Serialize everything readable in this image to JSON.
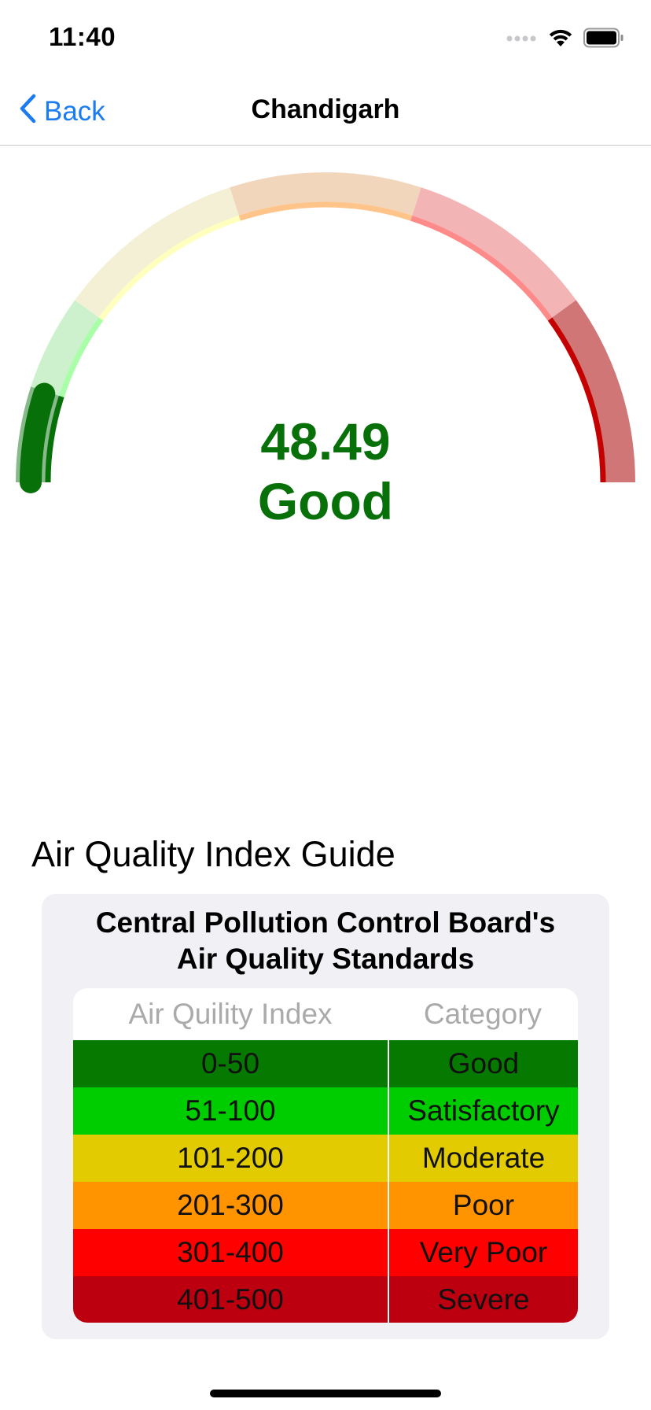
{
  "status_bar": {
    "time": "11:40",
    "icons": [
      "signal-dots-icon",
      "wifi-icon",
      "battery-icon"
    ]
  },
  "nav": {
    "back_label": "Back",
    "title": "Chandigarh",
    "accent_color": "#1a7cf0"
  },
  "gauge": {
    "value": "48.49",
    "category": "Good",
    "value_number": 48.49,
    "max": 500,
    "value_color": "#087008",
    "segments": [
      {
        "from": 0,
        "to": 50,
        "track_color": "#87b98a",
        "fill_color": "#087008"
      },
      {
        "from": 50,
        "to": 100,
        "track_color": "#cdf1cd",
        "fill_color": "#a8ffa8"
      },
      {
        "from": 100,
        "to": 200,
        "track_color": "#f4f0d6",
        "fill_color": "#ffffbe"
      },
      {
        "from": 200,
        "to": 300,
        "track_color": "#f2d6bc",
        "fill_color": "#ffc48a"
      },
      {
        "from": 300,
        "to": 400,
        "track_color": "#f2b4b4",
        "fill_color": "#ff8a8a"
      },
      {
        "from": 400,
        "to": 500,
        "track_color": "#d17676",
        "fill_color": "#c40000"
      }
    ]
  },
  "guide": {
    "heading": "Air Quality Index Guide",
    "card_title_line1": "Central Pollution Control Board's",
    "card_title_line2": "Air Quality Standards",
    "table": {
      "headers": [
        "Air Quility Index",
        "Category"
      ],
      "rows": [
        {
          "range": "0-50",
          "category": "Good",
          "color": "#067a00"
        },
        {
          "range": "51-100",
          "category": "Satisfactory",
          "color": "#00cd00"
        },
        {
          "range": "101-200",
          "category": "Moderate",
          "color": "#e2cb00"
        },
        {
          "range": "201-300",
          "category": "Poor",
          "color": "#ff9300"
        },
        {
          "range": "301-400",
          "category": "Very Poor",
          "color": "#ff0000"
        },
        {
          "range": "401-500",
          "category": "Severe",
          "color": "#bd0010"
        }
      ]
    }
  }
}
